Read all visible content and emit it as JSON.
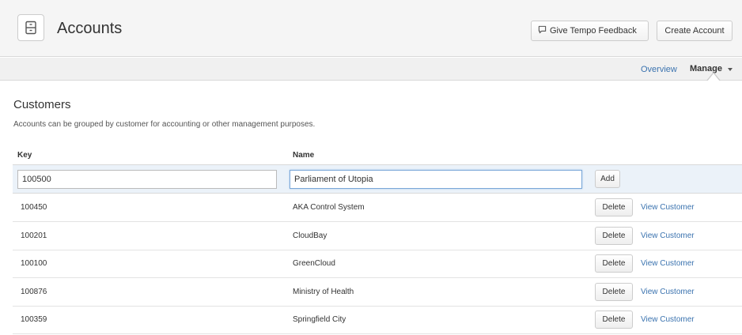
{
  "header": {
    "title": "Accounts",
    "feedback_label": "Give Tempo Feedback",
    "create_label": "Create Account",
    "app_icon": "accounts-icon",
    "feedback_icon": "speech-bubble-icon"
  },
  "subnav": {
    "overview_label": "Overview",
    "manage_label": "Manage",
    "active_tab": "Manage"
  },
  "section": {
    "title": "Customers",
    "description": "Accounts can be grouped by customer for accounting or other management purposes."
  },
  "table": {
    "columns": {
      "key": "Key",
      "name": "Name"
    },
    "new_row": {
      "key_value": "100500",
      "name_value": "Parliament of Utopia",
      "add_label": "Add"
    },
    "rows": [
      {
        "key": "100450",
        "name": "AKA Control System",
        "delete_label": "Delete",
        "view_label": "View Customer"
      },
      {
        "key": "100201",
        "name": "CloudBay",
        "delete_label": "Delete",
        "view_label": "View Customer"
      },
      {
        "key": "100100",
        "name": "GreenCloud",
        "delete_label": "Delete",
        "view_label": "View Customer"
      },
      {
        "key": "100876",
        "name": "Ministry of Health",
        "delete_label": "Delete",
        "view_label": "View Customer"
      },
      {
        "key": "100359",
        "name": "Springfield City",
        "delete_label": "Delete",
        "view_label": "View Customer"
      }
    ]
  },
  "colors": {
    "link": "#3b73af",
    "header_bg": "#f5f5f5",
    "add_row_bg": "#ebf2f9"
  }
}
